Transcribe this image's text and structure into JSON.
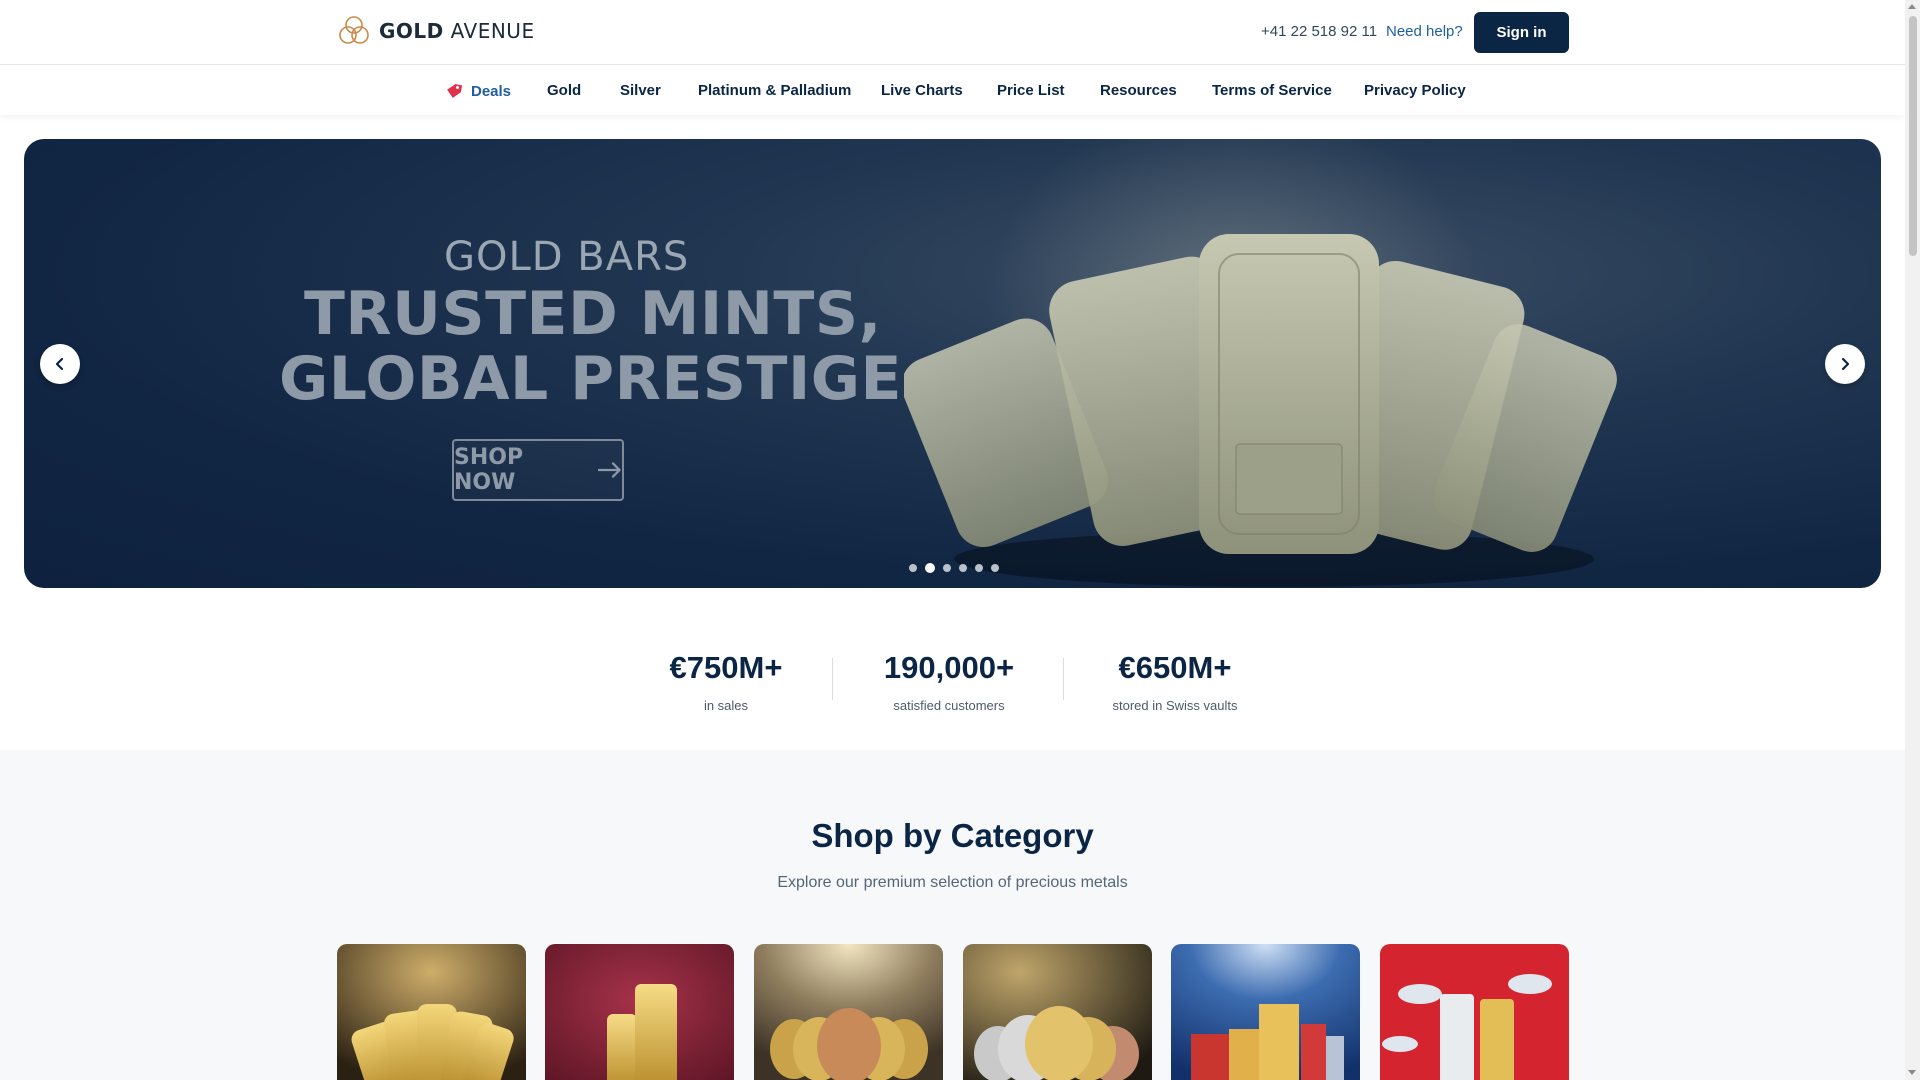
{
  "header": {
    "brand_bold": "GOLD",
    "brand_light": "AVENUE",
    "phone": "+41 22 518 92 11",
    "help_label": "Need help?",
    "signin_label": "Sign in"
  },
  "nav": {
    "items": [
      {
        "label": "Deals",
        "icon": "tag-icon"
      },
      {
        "label": "Gold"
      },
      {
        "label": "Silver"
      },
      {
        "label": "Platinum & Palladium"
      },
      {
        "label": "Live Charts"
      },
      {
        "label": "Price List"
      },
      {
        "label": "Resources"
      },
      {
        "label": "Terms of Service"
      },
      {
        "label": "Privacy Policy"
      }
    ]
  },
  "hero": {
    "eyebrow": "GOLD BARS",
    "line1": "TRUSTED MINTS,",
    "line2": "GLOBAL PRESTIGE",
    "cta_label": "SHOP NOW",
    "slides_total": 6,
    "active_slide": 2
  },
  "stats": [
    {
      "value": "€750M+",
      "label": "in sales"
    },
    {
      "value": "190,000+",
      "label": "satisfied customers"
    },
    {
      "value": "€650M+",
      "label": "stored in Swiss vaults"
    }
  ],
  "category": {
    "title": "Shop by Category",
    "subtitle": "Explore our premium selection of precious metals",
    "cards": [
      {
        "name": "gold-bars",
        "theme": "gold"
      },
      {
        "name": "minted-bars",
        "theme": "red"
      },
      {
        "name": "gold-coins",
        "theme": "gold"
      },
      {
        "name": "mixed-coins",
        "theme": "dark-gold"
      },
      {
        "name": "gifts",
        "theme": "blue"
      },
      {
        "name": "lunar-series",
        "theme": "red"
      }
    ]
  },
  "colors": {
    "navy": "#0b2545",
    "link_blue": "#1f5f9e",
    "deal_red": "#e0334a",
    "page_bg": "#f6f8fa"
  }
}
